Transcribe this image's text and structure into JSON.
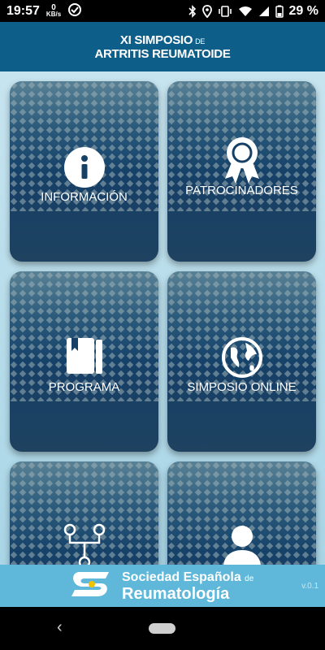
{
  "status_bar": {
    "time": "19:57",
    "kbs_value": "0",
    "kbs_unit": "KB/s",
    "battery": "29 %",
    "icons": [
      "data-saver-icon",
      "bluetooth-icon",
      "location-icon",
      "vibrate-icon",
      "wifi-icon",
      "signal-icon",
      "battery-icon"
    ]
  },
  "header": {
    "title_line1": "XI SIMPOSIO",
    "title_line1_suffix": "DE",
    "title_line2": "ARTRITIS REUMATOIDE"
  },
  "tiles": [
    {
      "label": "INFORMACIÓN",
      "icon": "info-icon"
    },
    {
      "label": "PATROCINADORES",
      "icon": "award-ribbon-icon"
    },
    {
      "label": "PROGRAMA",
      "icon": "book-icon"
    },
    {
      "label": "SIMPOSIO ONLINE",
      "icon": "globe-icon"
    },
    {
      "label": "",
      "icon": "network-nodes-icon"
    },
    {
      "label": "",
      "icon": "user-icon"
    }
  ],
  "footer": {
    "line1": "Sociedad Española",
    "line1_suffix": "de",
    "line2": "Reumatología",
    "version": "v.0.1"
  },
  "colors": {
    "header_bg": "#0e5e8a",
    "tile_bg": "#174067",
    "content_bg": "#b5dbe9",
    "footer_bg": "#5fb8d9"
  }
}
